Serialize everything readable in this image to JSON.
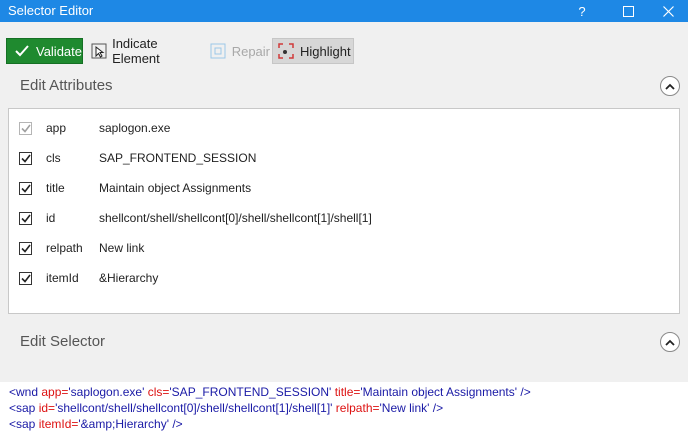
{
  "window": {
    "title": "Selector Editor",
    "help_label": "?"
  },
  "toolbar": {
    "validate_label": "Validate",
    "indicate_label": "Indicate Element",
    "repair_label": "Repair",
    "highlight_label": "Highlight"
  },
  "attributes": {
    "header": "Edit Attributes",
    "rows": [
      {
        "name": "app",
        "value": "saplogon.exe",
        "checked": true,
        "enabled": false
      },
      {
        "name": "cls",
        "value": "SAP_FRONTEND_SESSION",
        "checked": true,
        "enabled": true
      },
      {
        "name": "title",
        "value": "Maintain object Assignments",
        "checked": true,
        "enabled": true
      },
      {
        "name": "id",
        "value": "shellcont/shell/shellcont[0]/shell/shellcont[1]/shell[1]",
        "checked": true,
        "enabled": true
      },
      {
        "name": "relpath",
        "value": "New link",
        "checked": true,
        "enabled": true
      },
      {
        "name": "itemId",
        "value": "&Hierarchy",
        "checked": true,
        "enabled": true
      }
    ]
  },
  "selector": {
    "header": "Edit Selector",
    "lines": [
      [
        {
          "t": "<wnd ",
          "c": "tag"
        },
        {
          "t": "app=",
          "c": "attr"
        },
        {
          "t": "'saplogon.exe' ",
          "c": "str"
        },
        {
          "t": "cls=",
          "c": "attr"
        },
        {
          "t": "'SAP_FRONTEND_SESSION' ",
          "c": "str"
        },
        {
          "t": "title=",
          "c": "attr"
        },
        {
          "t": "'Maintain object Assignments' ",
          "c": "str"
        },
        {
          "t": "/>",
          "c": "tag"
        }
      ],
      [
        {
          "t": "<sap ",
          "c": "tag"
        },
        {
          "t": "id=",
          "c": "attr"
        },
        {
          "t": "'shellcont/shell/shellcont[0]/shell/shellcont[1]/shell[1]' ",
          "c": "str"
        },
        {
          "t": "relpath=",
          "c": "attr"
        },
        {
          "t": "'New link' ",
          "c": "str"
        },
        {
          "t": "/>",
          "c": "tag"
        }
      ],
      [
        {
          "t": "<sap ",
          "c": "tag"
        },
        {
          "t": "itemId=",
          "c": "attr"
        },
        {
          "t": "'&amp;Hierarchy' ",
          "c": "str"
        },
        {
          "t": "/>",
          "c": "tag"
        }
      ]
    ]
  },
  "colors": {
    "titlebar": "#1e88e5",
    "validate": "#1f8a2f",
    "tag": "#1a1aa6",
    "attribute": "#dd1111"
  }
}
